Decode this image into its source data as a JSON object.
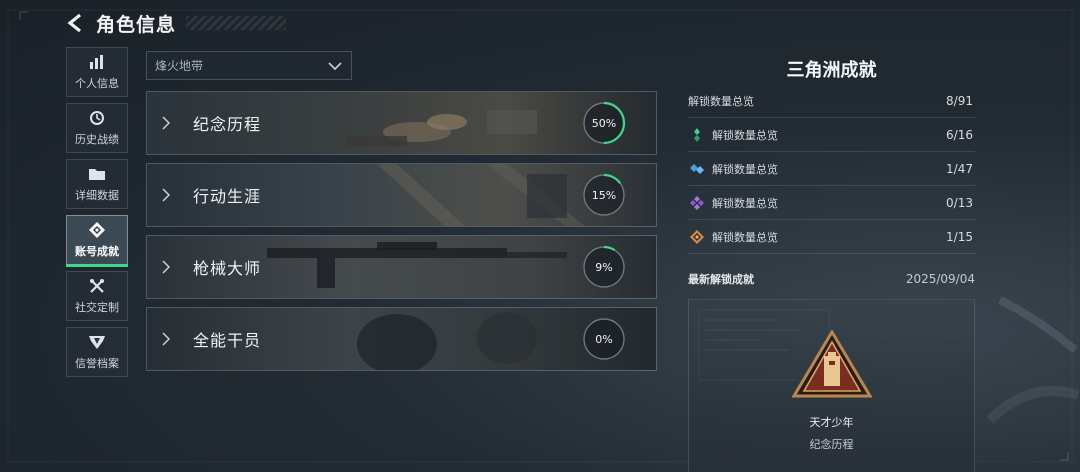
{
  "header": {
    "title": "角色信息",
    "back_icon": "back-arrow-icon"
  },
  "sidebar": {
    "items": [
      {
        "label": "个人信息",
        "icon": "bar-chart-icon",
        "active": false
      },
      {
        "label": "历史战绩",
        "icon": "history-clock-icon",
        "active": false
      },
      {
        "label": "详细数据",
        "icon": "folder-icon",
        "active": false
      },
      {
        "label": "账号成就",
        "icon": "achievement-badge-icon",
        "active": true
      },
      {
        "label": "社交定制",
        "icon": "tools-icon",
        "active": false
      },
      {
        "label": "信誉档案",
        "icon": "shield-wings-icon",
        "active": false
      }
    ]
  },
  "filter": {
    "selected": "烽火地带",
    "icon": "chevron-down-icon"
  },
  "categories": [
    {
      "label": "纪念历程",
      "percent_text": "50%",
      "progress": 0.5
    },
    {
      "label": "行动生涯",
      "percent_text": "15%",
      "progress": 0.15
    },
    {
      "label": "枪械大师",
      "percent_text": "9%",
      "progress": 0.09
    },
    {
      "label": "全能干员",
      "percent_text": "0%",
      "progress": 0.0
    }
  ],
  "panel": {
    "title": "三角洲成就",
    "total": {
      "label": "解锁数量总览",
      "value": "8/91"
    },
    "tiers": [
      {
        "label": "解锁数量总览",
        "value": "6/16",
        "icon": "green-tier-icon",
        "color": "#3fcf8a"
      },
      {
        "label": "解锁数量总览",
        "value": "1/47",
        "icon": "blue-tier-icon",
        "color": "#4a9fe0"
      },
      {
        "label": "解锁数量总览",
        "value": "0/13",
        "icon": "purple-tier-icon",
        "color": "#a874e8"
      },
      {
        "label": "解锁数量总览",
        "value": "1/15",
        "icon": "gold-tier-icon",
        "color": "#d98a4a"
      }
    ],
    "latest": {
      "label": "最新解锁成就",
      "date": "2025/09/04",
      "name": "天才少年",
      "category": "纪念历程",
      "icon": "triangle-achievement-badge-icon"
    }
  },
  "colors": {
    "accent": "#3fd98a",
    "progress_track": "#6d767e",
    "progress_fill": "#3fd98a"
  }
}
